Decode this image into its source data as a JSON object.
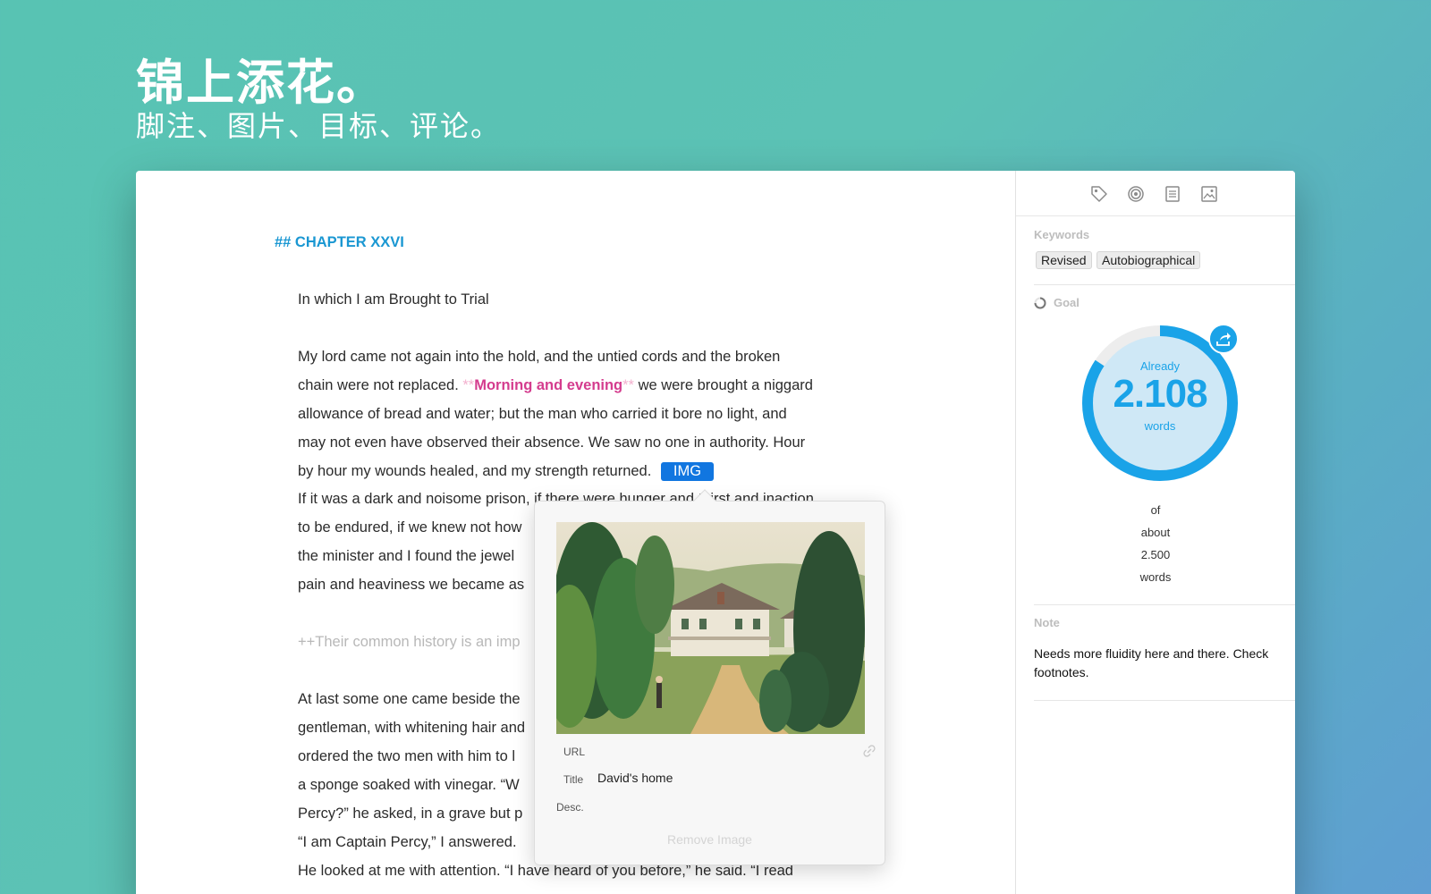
{
  "hero": {
    "title": "锦上添花。",
    "subtitle": "脚注、图片、目标、评论。"
  },
  "editor": {
    "heading": "## CHAPTER XXVI",
    "subheading": "In which I am Brought to Trial",
    "lines": {
      "l1": "My lord came not again into the hold, and the untied cords and the broken",
      "l2_pre": "chain were not replaced. ",
      "l2_md_open": "**",
      "l2_em": "Morning and evening",
      "l2_md_close": "**",
      "l2_post": " we were brought a niggard",
      "l3": "allowance of bread and water; but the man who carried it bore no light, and",
      "l4": "may not even have observed their absence. We saw no one in authority. Hour",
      "l5_pre": "by hour my wounds healed, and my strength returned.",
      "l5_tag": "IMG",
      "l6": "If it was a dark and noisome prison, if there were hunger and thirst and inaction",
      "l7": "to be endured, if we knew not how",
      "l8": "the minister and I found the jewel",
      "l9": "pain and heaviness we became as",
      "l10": "++Their common history is an imp",
      "l11": "At last some one came beside the",
      "l12": "gentleman, with whitening hair and",
      "l13": "ordered the two men with him to l",
      "l14": "a sponge soaked with vinegar. “W",
      "l15": "Percy?” he asked, in a grave but p",
      "l16": "“I am Captain Percy,” I answered.",
      "l17": "He looked at me with attention. “I have heard of you before,” he said. “I read"
    }
  },
  "image_popover": {
    "url_label": "URL",
    "url_value": "",
    "title_label": "Title",
    "title_value": "David's home",
    "desc_label": "Desc.",
    "desc_value": "",
    "remove_button": "Remove Image",
    "link_icon": "link-icon",
    "preview_icon": "house-landscape-image"
  },
  "sidebar": {
    "toolbar_icons": [
      "tag-icon",
      "target-icon",
      "document-icon",
      "image-icon"
    ],
    "keywords_label": "Keywords",
    "keywords": [
      "Revised",
      "Autobiographical"
    ],
    "goal_label": "Goal",
    "goal": {
      "already_label": "Already",
      "current": "2.108",
      "current_unit": "words",
      "of_label": "of",
      "about_label": "about",
      "target": "2.500",
      "target_unit": "words",
      "progress": 0.8432,
      "ring_color": "#1aa3e8",
      "share_icon": "share-icon"
    },
    "note_label": "Note",
    "note_text": "Needs more fluidity here and there. Check footnotes."
  },
  "colors": {
    "heading": "#1a97d2",
    "emphasis": "#d43c8e",
    "markdown_markers": "#f3b0ce",
    "img_tag": "#1176e0",
    "accent": "#1aa3e8"
  }
}
